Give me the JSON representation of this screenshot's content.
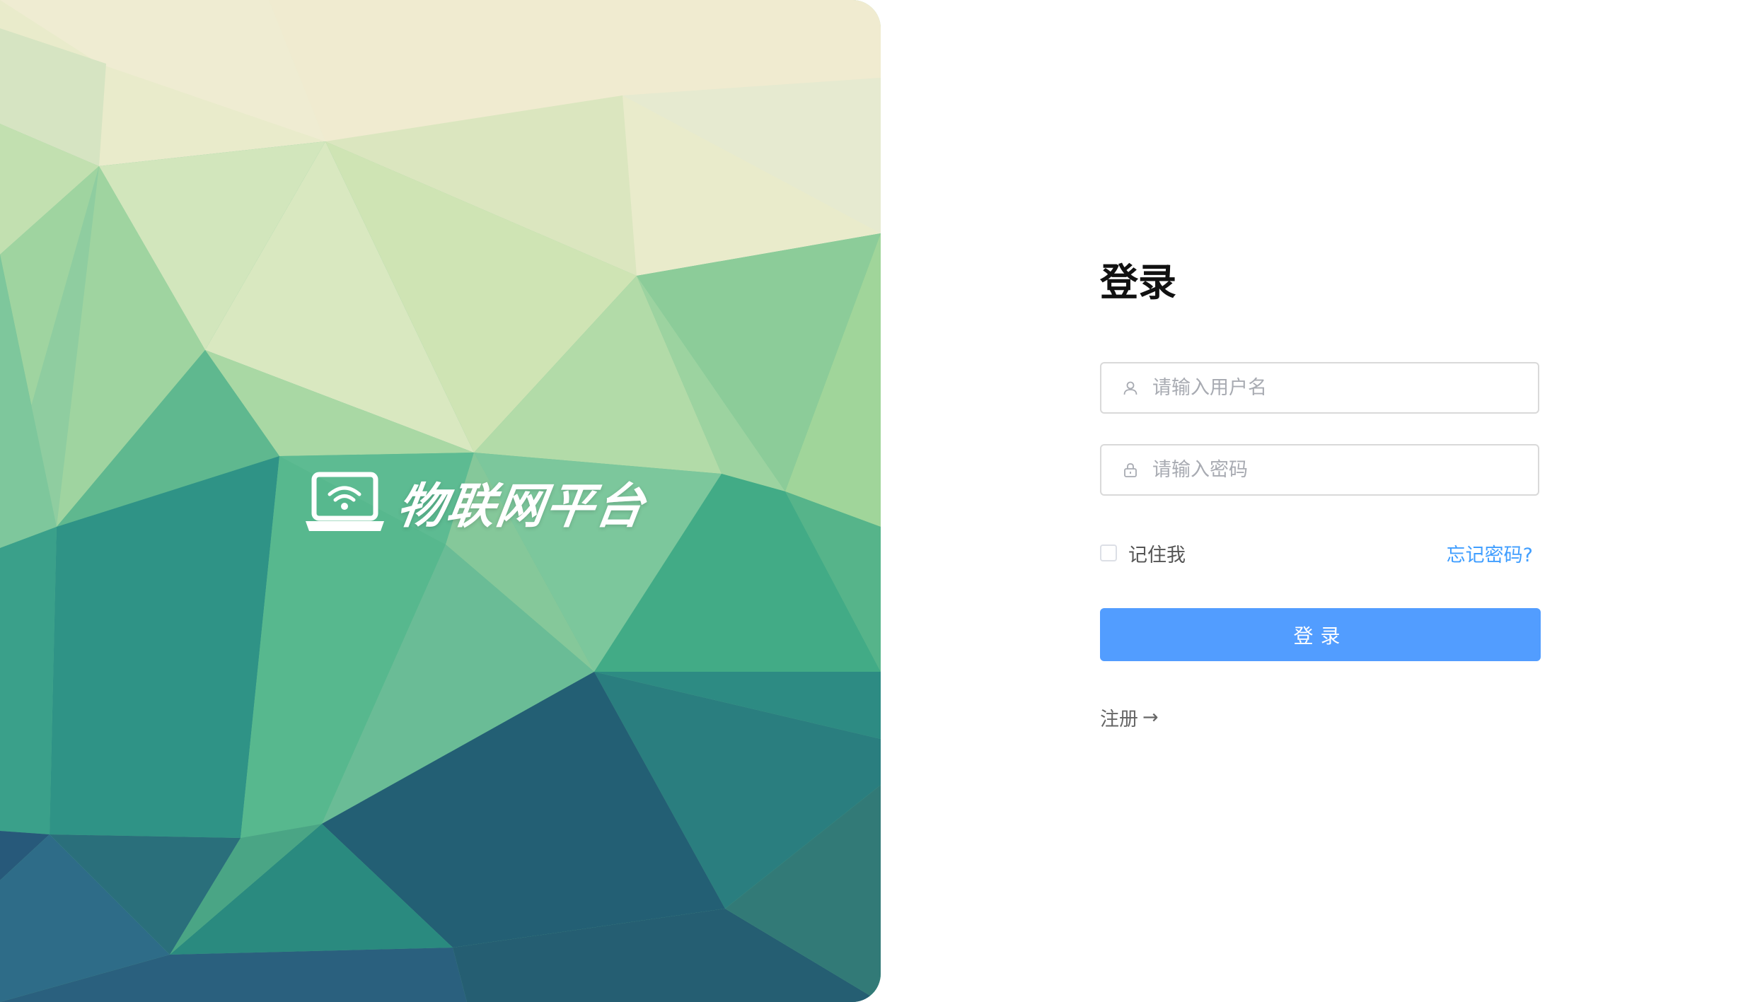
{
  "brand": {
    "title": "物联网平台",
    "icon": "laptop-wifi-icon"
  },
  "login": {
    "title": "登录",
    "username_placeholder": "请输入用户名",
    "password_placeholder": "请输入密码",
    "remember_label": "记住我",
    "forgot_label": "忘记密码?",
    "submit_label": "登录",
    "register_label": "注册",
    "register_arrow": "→"
  },
  "icons": {
    "user": "user-icon",
    "lock": "lock-icon"
  },
  "colors": {
    "primary": "#529dff",
    "link": "#409eff",
    "border": "#d9d9d9",
    "placeholder": "#a8abb2"
  }
}
